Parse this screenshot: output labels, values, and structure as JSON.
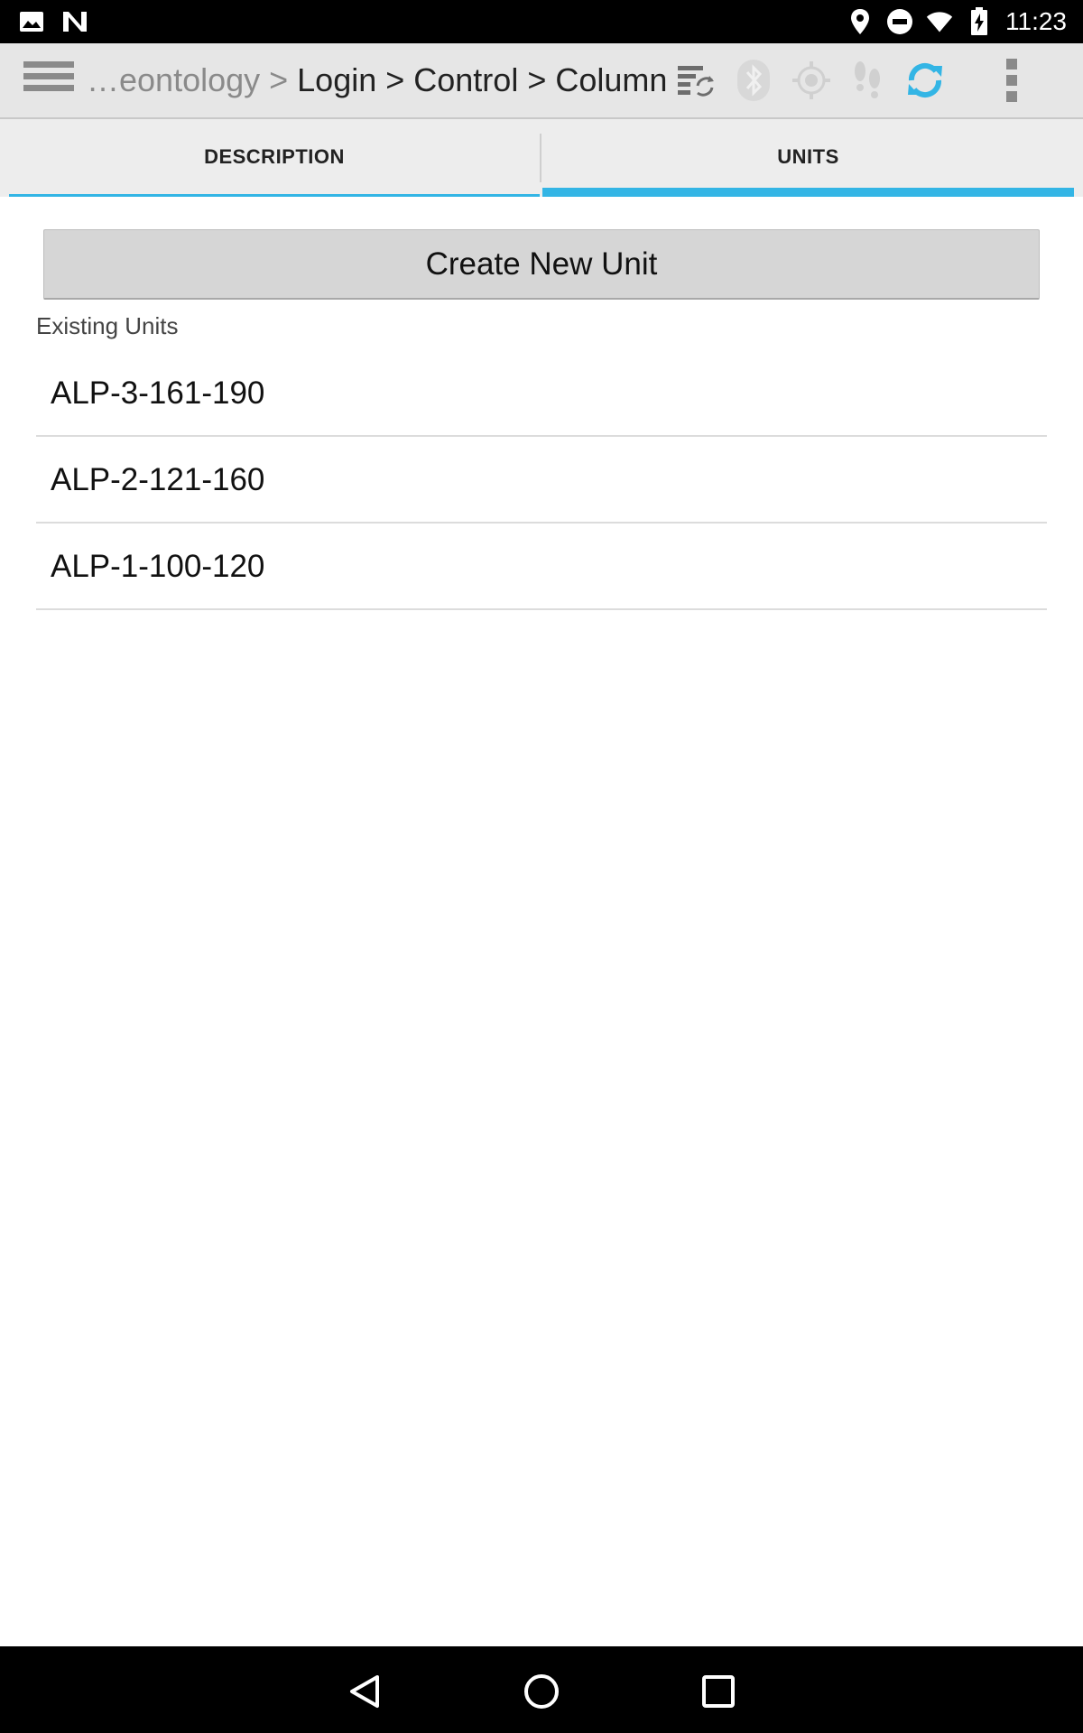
{
  "status_bar": {
    "time": "11:23",
    "left_icons": [
      "image-icon",
      "n-logo-icon"
    ],
    "right_icons": [
      "location-icon",
      "do-not-disturb-icon",
      "wifi-icon",
      "battery-charging-icon"
    ]
  },
  "action_bar": {
    "breadcrumb_prefix": "…eontology > ",
    "breadcrumb_path": "Login > Control > Column",
    "icons": [
      "sync-records-icon",
      "bluetooth-icon",
      "gps-icon",
      "footsteps-icon",
      "refresh-icon",
      "overflow-menu-icon"
    ],
    "accent": "#33b5e5"
  },
  "tabs": [
    {
      "label": "DESCRIPTION",
      "selected": false
    },
    {
      "label": "UNITS",
      "selected": true
    }
  ],
  "main": {
    "create_button_label": "Create New Unit",
    "section_label": "Existing Units",
    "units": [
      "ALP-3-161-190",
      "ALP-2-121-160",
      "ALP-1-100-120"
    ]
  },
  "nav_bar": {
    "icons": [
      "back-icon",
      "home-icon",
      "recents-icon"
    ]
  }
}
